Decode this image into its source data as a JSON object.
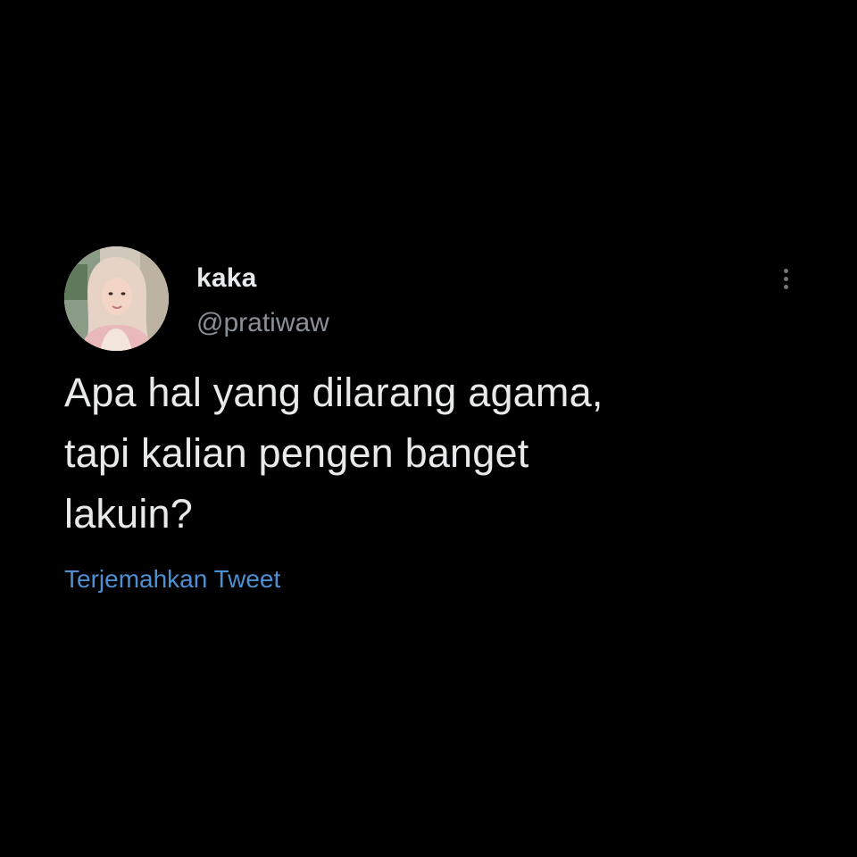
{
  "tweet": {
    "author": {
      "display_name": "kaka",
      "handle": "@pratiwaw",
      "avatar_icon": "user-avatar-photo"
    },
    "more_icon": "more-vertical-icon",
    "text_lines": [
      "Apa hal yang dilarang agama,",
      "tapi kalian pengen banget",
      "lakuin?"
    ],
    "translate_label": "Terjemahkan Tweet"
  },
  "colors": {
    "background": "#000000",
    "primary_text": "#e7e9ea",
    "secondary_text": "#8b9096",
    "link": "#4e8fd1"
  }
}
